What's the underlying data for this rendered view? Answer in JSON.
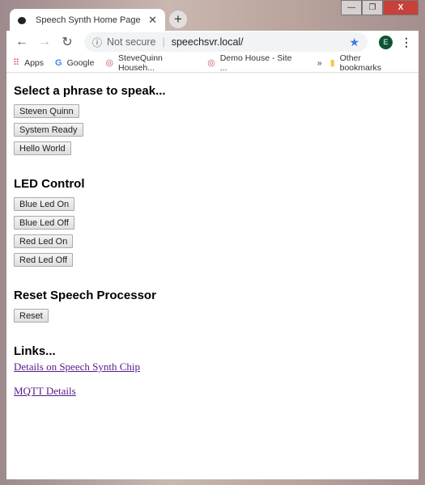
{
  "window": {
    "minimize": "—",
    "restore": "❐",
    "close": "X"
  },
  "tab": {
    "title": "Speech Synth Home Page",
    "close": "✕",
    "new_tab": "+"
  },
  "toolbar": {
    "back": "←",
    "forward": "→",
    "reload": "↻",
    "info_icon": "ⓘ",
    "security": "Not secure",
    "url": "speechsvr.local/",
    "star": "★",
    "avatar": "E",
    "menu": "⋮"
  },
  "bookmarks": {
    "items": [
      {
        "label": "Apps",
        "icon": "apps-grid-icon"
      },
      {
        "label": "Google",
        "icon": "google-icon"
      },
      {
        "label": "SteveQuinn Househ...",
        "icon": "site-icon"
      },
      {
        "label": "Demo House - Site ...",
        "icon": "site-icon"
      }
    ],
    "overflow": "»",
    "other": "Other bookmarks"
  },
  "page": {
    "phrases": {
      "heading": "Select a phrase to speak...",
      "buttons": [
        "Steven Quinn",
        "System Ready",
        "Hello World"
      ]
    },
    "led": {
      "heading": "LED Control",
      "buttons": [
        "Blue Led On",
        "Blue Led Off",
        "Red Led On",
        "Red Led Off"
      ]
    },
    "reset": {
      "heading": "Reset Speech Processor",
      "button": "Reset"
    },
    "links": {
      "heading": "Links...",
      "items": [
        "Details on Speech Synth Chip",
        "MQTT Details"
      ]
    }
  }
}
